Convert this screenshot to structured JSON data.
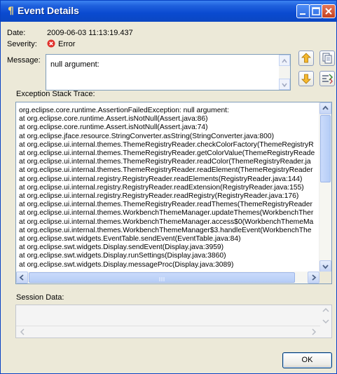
{
  "window": {
    "title": "Event Details"
  },
  "date": {
    "label": "Date:",
    "value": "2009-06-03 11:13:19.437"
  },
  "severity": {
    "label": "Severity:",
    "value": "Error",
    "icon": "error-icon",
    "icon_color": "#e0302b"
  },
  "message": {
    "label": "Message:",
    "value": "null argument:"
  },
  "nav": {
    "up_icon": "arrow-up-icon",
    "down_icon": "arrow-down-icon",
    "copy_icon": "copy-icon",
    "filter_icon": "filter-icon"
  },
  "stack": {
    "label": "Exception Stack Trace:",
    "lines": [
      "org.eclipse.core.runtime.AssertionFailedException: null argument:",
      "at org.eclipse.core.runtime.Assert.isNotNull(Assert.java:86)",
      "at org.eclipse.core.runtime.Assert.isNotNull(Assert.java:74)",
      "at org.eclipse.jface.resource.StringConverter.asString(StringConverter.java:800)",
      "at org.eclipse.ui.internal.themes.ThemeRegistryReader.checkColorFactory(ThemeRegistryR",
      "at org.eclipse.ui.internal.themes.ThemeRegistryReader.getColorValue(ThemeRegistryReade",
      "at org.eclipse.ui.internal.themes.ThemeRegistryReader.readColor(ThemeRegistryReader.ja",
      "at org.eclipse.ui.internal.themes.ThemeRegistryReader.readElement(ThemeRegistryReader",
      "at org.eclipse.ui.internal.registry.RegistryReader.readElements(RegistryReader.java:144)",
      "at org.eclipse.ui.internal.registry.RegistryReader.readExtension(RegistryReader.java:155)",
      "at org.eclipse.ui.internal.registry.RegistryReader.readRegistry(RegistryReader.java:176)",
      "at org.eclipse.ui.internal.themes.ThemeRegistryReader.readThemes(ThemeRegistryReader",
      "at org.eclipse.ui.internal.themes.WorkbenchThemeManager.updateThemes(WorkbenchTher",
      "at org.eclipse.ui.internal.themes.WorkbenchThemeManager.access$0(WorkbenchThemeMa",
      "at org.eclipse.ui.internal.themes.WorkbenchThemeManager$3.handleEvent(WorkbenchThe",
      "at org.eclipse.swt.widgets.EventTable.sendEvent(EventTable.java:84)",
      "at org.eclipse.swt.widgets.Display.sendEvent(Display.java:3959)",
      "at org.eclipse.swt.widgets.Display.runSettings(Display.java:3860)",
      "at org.eclipse.swt.widgets.Display.messageProc(Display.java:3089)"
    ]
  },
  "session": {
    "label": "Session Data:"
  },
  "buttons": {
    "ok": "OK"
  },
  "colors": {
    "titlebar": "#0a4ad0",
    "dialog_bg": "#ece9d8",
    "close_button": "#c44120"
  }
}
